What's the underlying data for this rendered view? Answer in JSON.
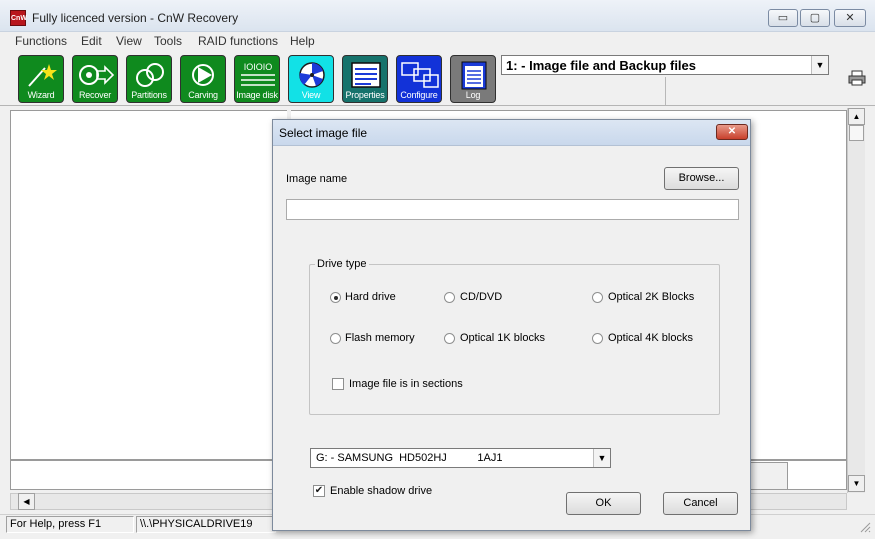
{
  "window": {
    "title": "Fully licenced version - CnW Recovery",
    "app_icon_text": "CnW",
    "controls": {
      "minimize": "▭",
      "maximize": "▢",
      "close": "✕"
    }
  },
  "menu": [
    "Functions",
    "Edit",
    "View",
    "Tools",
    "RAID functions",
    "Help"
  ],
  "toolbar": {
    "buttons": [
      "Wizard",
      "Recover",
      "Partitions",
      "Carving",
      "Image disk",
      "View",
      "Properties",
      "Configure",
      "Log"
    ],
    "image_disk_glyph_text": "IOIOIO",
    "combo_value": "1: - Image file and Backup files",
    "combo_arrow": "▼"
  },
  "scroll": {
    "up": "▲",
    "down": "▼",
    "left": "◀",
    "right": "▶"
  },
  "status": {
    "help_text": "For Help, press F1",
    "drive": "\\\\.\\PHYSICALDRIVE19"
  },
  "dialog": {
    "title": "Select image file",
    "close": "✕",
    "image_name_label": "Image name",
    "browse_label": "Browse...",
    "image_name_value": "",
    "drive_type_label": "Drive type",
    "drive_types": [
      "Hard drive",
      "CD/DVD",
      "Optical 2K Blocks",
      "Flash memory",
      "Optical 1K blocks",
      "Optical 4K blocks"
    ],
    "selected_drive_type": "Hard drive",
    "sections_label": "Image file is in sections",
    "sections_checked": false,
    "drive_combo_value": "G: - SAMSUNG  HD502HJ          1AJ1",
    "shadow_label": "Enable shadow drive",
    "shadow_checked": true,
    "check_mark": "✔",
    "ok_label": "OK",
    "cancel_label": "Cancel"
  }
}
